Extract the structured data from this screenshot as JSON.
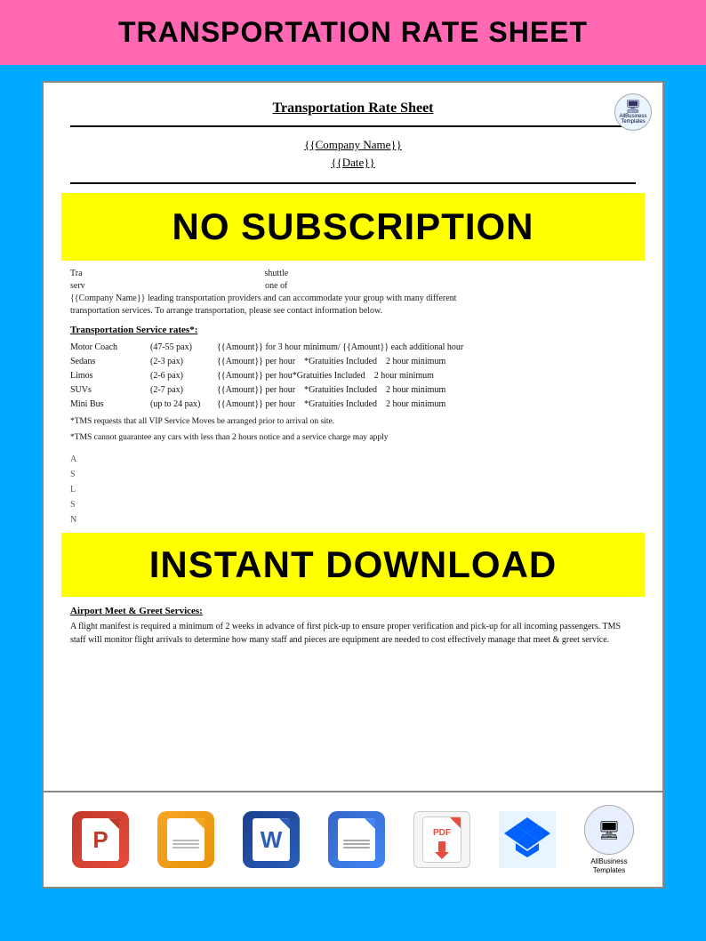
{
  "header": {
    "title": "TRANSPORTATION RATE SHEET",
    "bg_color": "#ff69b4"
  },
  "document": {
    "title": "Transportation Rate Sheet",
    "company_placeholder": "{{Company Name}}",
    "date_placeholder": "{{Date}}",
    "intro_text_visible": "services. To arrange transportation, please see contact information below.",
    "rates_section_title": "Transportation Service rates*:",
    "rates": [
      {
        "vehicle": "Motor Coach",
        "pax": "(47-55 pax)",
        "rate": "{{Amount}} for 3 hour minimum/ {{Amount}} each additional hour"
      },
      {
        "vehicle": "Sedans",
        "pax": "(2-3 pax)",
        "rate": "{{Amount}} per hour    *Gratuities Included    2 hour minimum"
      },
      {
        "vehicle": "Limos",
        "pax": "(2-6 pax)",
        "rate": "{{Amount}} per hour  *Gratuities Included    2 hour minimum"
      },
      {
        "vehicle": "SUVs",
        "pax": "(2-7 pax)",
        "rate": "{{Amount}} per hour    *Gratuities Included    2 hour minimum"
      },
      {
        "vehicle": "Mini Bus",
        "pax": "(up to 24 pax)",
        "rate": "{{Amount}} per hour    *Gratuities Included    2 hour minimum"
      }
    ],
    "footnotes": [
      "*TMS requests that all VIP Service Moves be arranged prior to arrival on site.",
      "*TMS cannot guarantee any cars with less than 2 hours notice and a service charge may apply"
    ],
    "airport_title": "Airport Meet & Greet Services:",
    "airport_text": "A flight manifest is required a minimum of 2 weeks in advance of first pick-up to ensure proper verification and pick-up for all incoming passengers.  TMS staff will monitor flight arrivals to determine how many staff and pieces are equipment are needed to cost effectively manage that meet & greet service."
  },
  "overlays": {
    "no_subscription": "NO SUBSCRIPTION",
    "instant_download": "INSTANT DOWNLOAD"
  },
  "bottom_icons": [
    {
      "id": "powerpoint",
      "label": "PowerPoint",
      "letter": "P",
      "color": "#c0392b"
    },
    {
      "id": "google-slides",
      "label": "Google Slides",
      "color": "#f5a623"
    },
    {
      "id": "word",
      "label": "Word",
      "letter": "W",
      "color": "#2b5eb8"
    },
    {
      "id": "google-docs",
      "label": "Google Docs",
      "color": "#4285f4"
    },
    {
      "id": "pdf",
      "label": "PDF"
    },
    {
      "id": "dropbox",
      "label": "Dropbox",
      "color": "#0061ff"
    },
    {
      "id": "allbusiness",
      "label": "AllBusiness\nTemplates"
    }
  ],
  "allbiz_logo": "AllBusiness\nTemplates",
  "detected_text": {
    "hour": "hour",
    "included1": "Included",
    "included2": "Included",
    "included3": "Included"
  }
}
